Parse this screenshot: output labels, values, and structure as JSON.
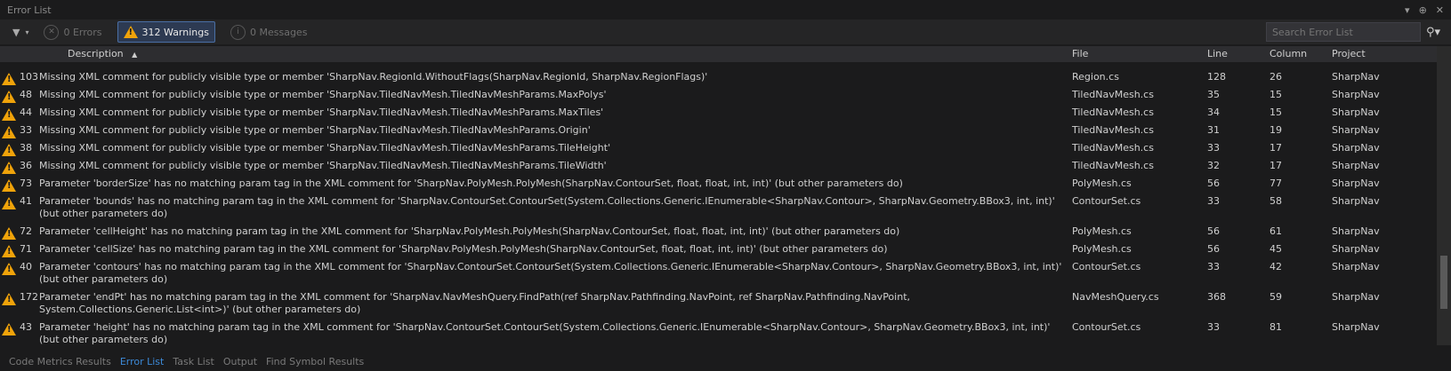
{
  "window": {
    "title": "Error List",
    "buttons": [
      "▾",
      "⊕",
      "✕"
    ]
  },
  "toolbar": {
    "filter_icon": "filter-icon",
    "errors_label": "0 Errors",
    "warnings_label": "312 Warnings",
    "messages_label": "0 Messages",
    "search_placeholder": "Search Error List"
  },
  "columns": {
    "description": "Description",
    "file": "File",
    "line": "Line",
    "column": "Column",
    "project": "Project"
  },
  "rows": [
    {
      "num": "103",
      "desc": "Missing XML comment for publicly visible type or member 'SharpNav.RegionId.WithoutFlags(SharpNav.RegionId, SharpNav.RegionFlags)'",
      "file": "Region.cs",
      "line": "128",
      "col": "26",
      "proj": "SharpNav"
    },
    {
      "num": "48",
      "desc": "Missing XML comment for publicly visible type or member 'SharpNav.TiledNavMesh.TiledNavMeshParams.MaxPolys'",
      "file": "TiledNavMesh.cs",
      "line": "35",
      "col": "15",
      "proj": "SharpNav"
    },
    {
      "num": "44",
      "desc": "Missing XML comment for publicly visible type or member 'SharpNav.TiledNavMesh.TiledNavMeshParams.MaxTiles'",
      "file": "TiledNavMesh.cs",
      "line": "34",
      "col": "15",
      "proj": "SharpNav"
    },
    {
      "num": "33",
      "desc": "Missing XML comment for publicly visible type or member 'SharpNav.TiledNavMesh.TiledNavMeshParams.Origin'",
      "file": "TiledNavMesh.cs",
      "line": "31",
      "col": "19",
      "proj": "SharpNav"
    },
    {
      "num": "38",
      "desc": "Missing XML comment for publicly visible type or member 'SharpNav.TiledNavMesh.TiledNavMeshParams.TileHeight'",
      "file": "TiledNavMesh.cs",
      "line": "33",
      "col": "17",
      "proj": "SharpNav"
    },
    {
      "num": "36",
      "desc": "Missing XML comment for publicly visible type or member 'SharpNav.TiledNavMesh.TiledNavMeshParams.TileWidth'",
      "file": "TiledNavMesh.cs",
      "line": "32",
      "col": "17",
      "proj": "SharpNav"
    },
    {
      "num": "73",
      "desc": "Parameter 'borderSize' has no matching param tag in the XML comment for 'SharpNav.PolyMesh.PolyMesh(SharpNav.ContourSet, float, float, int, int)' (but other parameters do)",
      "file": "PolyMesh.cs",
      "line": "56",
      "col": "77",
      "proj": "SharpNav"
    },
    {
      "num": "41",
      "desc": "Parameter 'bounds' has no matching param tag in the XML comment for 'SharpNav.ContourSet.ContourSet(System.Collections.Generic.IEnumerable<SharpNav.Contour>, SharpNav.Geometry.BBox3, int, int)' (but other parameters do)",
      "file": "ContourSet.cs",
      "line": "33",
      "col": "58",
      "proj": "SharpNav"
    },
    {
      "num": "72",
      "desc": "Parameter 'cellHeight' has no matching param tag in the XML comment for 'SharpNav.PolyMesh.PolyMesh(SharpNav.ContourSet, float, float, int, int)' (but other parameters do)",
      "file": "PolyMesh.cs",
      "line": "56",
      "col": "61",
      "proj": "SharpNav"
    },
    {
      "num": "71",
      "desc": "Parameter 'cellSize' has no matching param tag in the XML comment for 'SharpNav.PolyMesh.PolyMesh(SharpNav.ContourSet, float, float, int, int)' (but other parameters do)",
      "file": "PolyMesh.cs",
      "line": "56",
      "col": "45",
      "proj": "SharpNav"
    },
    {
      "num": "40",
      "desc": "Parameter 'contours' has no matching param tag in the XML comment for 'SharpNav.ContourSet.ContourSet(System.Collections.Generic.IEnumerable<SharpNav.Contour>, SharpNav.Geometry.BBox3, int, int)' (but other parameters do)",
      "file": "ContourSet.cs",
      "line": "33",
      "col": "42",
      "proj": "SharpNav"
    },
    {
      "num": "172",
      "desc": "Parameter 'endPt' has no matching param tag in the XML comment for 'SharpNav.NavMeshQuery.FindPath(ref SharpNav.Pathfinding.NavPoint, ref SharpNav.Pathfinding.NavPoint, System.Collections.Generic.List<int>)' (but other parameters do)",
      "file": "NavMeshQuery.cs",
      "line": "368",
      "col": "59",
      "proj": "SharpNav"
    },
    {
      "num": "43",
      "desc": "Parameter 'height' has no matching param tag in the XML comment for 'SharpNav.ContourSet.ContourSet(System.Collections.Generic.IEnumerable<SharpNav.Contour>, SharpNav.Geometry.BBox3, int, int)' (but other parameters do)",
      "file": "ContourSet.cs",
      "line": "33",
      "col": "81",
      "proj": "SharpNav"
    }
  ],
  "tabs": [
    "Code Metrics Results",
    "Error List",
    "Task List",
    "Output",
    "Find Symbol Results"
  ],
  "active_tab": "Error List",
  "colors": {
    "accent": "#3c8ad8",
    "warning": "#f0a30a",
    "background": "#1b1b1c"
  }
}
